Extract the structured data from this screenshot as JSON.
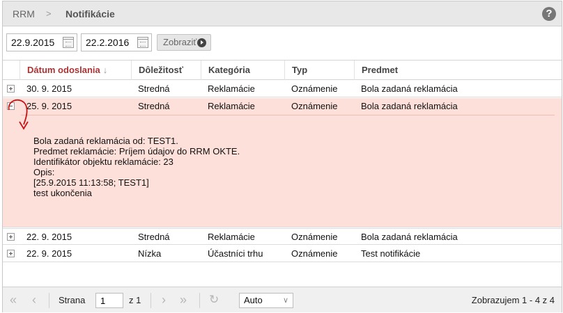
{
  "header": {
    "breadcrumb_root": "RRM",
    "breadcrumb_sep": ">",
    "breadcrumb_current": "Notifikácie",
    "help_label": "?"
  },
  "filter": {
    "date_from": "22.9.2015",
    "date_to": "22.2.2016",
    "show_label": "Zobraziť"
  },
  "grid": {
    "columns": [
      "Dátum odoslania",
      "Dôležitosť",
      "Kategória",
      "Typ",
      "Predmet"
    ],
    "sort_arrow": "↓",
    "rows": [
      {
        "date": "30. 9. 2015",
        "importance": "Stredná",
        "category": "Reklamácie",
        "type": "Oznámenie",
        "subject": "Bola zadaná reklamácia"
      },
      {
        "date": "25. 9. 2015",
        "importance": "Stredná",
        "category": "Reklamácie",
        "type": "Oznámenie",
        "subject": "Bola zadaná reklamácia"
      },
      {
        "date": "22. 9. 2015",
        "importance": "Stredná",
        "category": "Reklamácie",
        "type": "Oznámenie",
        "subject": "Bola zadaná reklamácia"
      },
      {
        "date": "22. 9. 2015",
        "importance": "Nízka",
        "category": "Účastníci trhu",
        "type": "Oznámenie",
        "subject": "Test notifikácie"
      }
    ],
    "detail_text": "Bola zadaná reklamácia od: TEST1.\nPredmet reklamácie: Príjem údajov do RRM OKTE.\nIdentifikátor objektu reklamácie: 23\nOpis:\n[25.9.2015 11:13:58; TEST1]\ntest ukončenia"
  },
  "pager": {
    "page_label": "Strana",
    "page_value": "1",
    "of_label": "z 1",
    "page_size": "Auto",
    "info": "Zobrazujem 1 - 4 z 4"
  },
  "colors": {
    "expanded_row": "#fde0da",
    "sorted_header": "#a33333",
    "annotation": "#cc1111"
  }
}
